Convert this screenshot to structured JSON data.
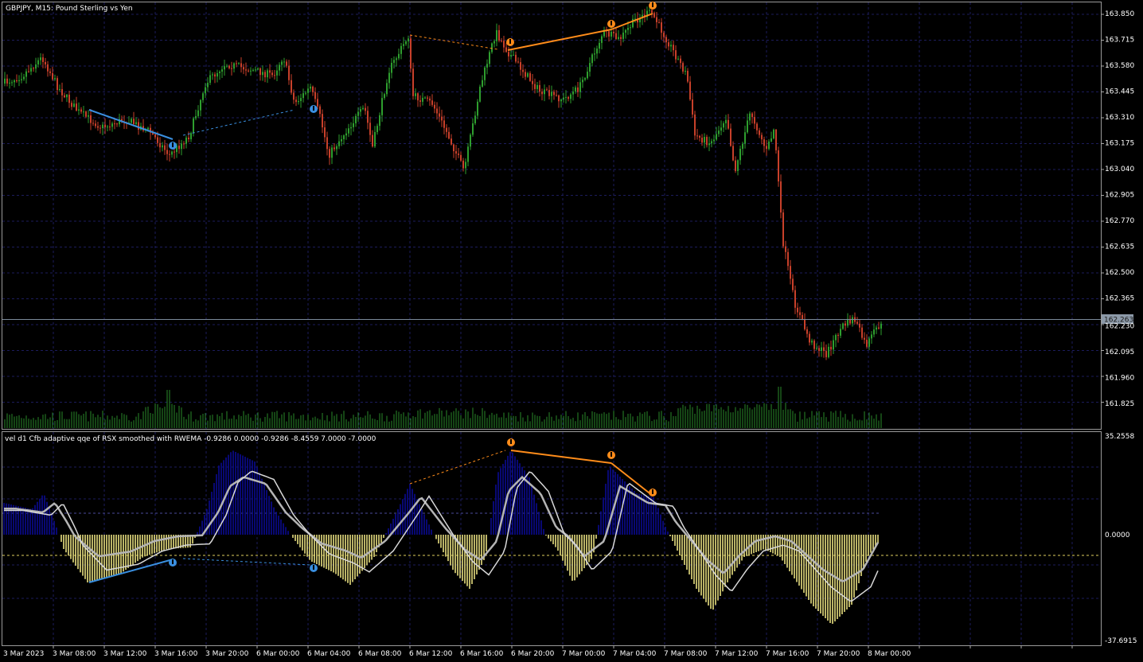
{
  "main": {
    "title": "GBPJPY, M15:  Pound Sterling vs Yen",
    "price_labels": [
      "163.850",
      "163.715",
      "163.580",
      "163.445",
      "163.310",
      "163.175",
      "163.040",
      "162.905",
      "162.770",
      "162.635",
      "162.500",
      "162.365",
      "162.230",
      "162.095",
      "161.960",
      "161.825"
    ],
    "current_price": "162.263"
  },
  "indicator": {
    "title": "vel d1 Cfb adaptive qqe of RSX smoothed with RWEMA -0.9286 0.0000 -0.9286 -8.4559 7.0000 -7.0000",
    "scale_labels": [
      "35.2558",
      "0.0000",
      "-37.6915"
    ]
  },
  "time_labels": [
    "3 Mar 2023",
    "3 Mar 08:00",
    "3 Mar 12:00",
    "3 Mar 16:00",
    "3 Mar 20:00",
    "6 Mar 00:00",
    "6 Mar 04:00",
    "6 Mar 08:00",
    "6 Mar 12:00",
    "6 Mar 16:00",
    "6 Mar 20:00",
    "7 Mar 00:00",
    "7 Mar 04:00",
    "7 Mar 08:00",
    "7 Mar 12:00",
    "7 Mar 16:00",
    "7 Mar 20:00",
    "8 Mar 00:00"
  ],
  "colors": {
    "background": "#000000",
    "grid": "#1c1c5c",
    "bull_candle": "#2e9e2e",
    "bear_candle": "#c8402a",
    "volume": "#2a8a2a",
    "positive_histogram": "#0a0a90",
    "negative_histogram": "#e8e080",
    "neutral_histogram": "#808080",
    "signal_line": "#b4b4b4",
    "bearish_divergence": "#ff8c1a",
    "bullish_divergence": "#3a8fe0",
    "price_line": "#7a8a9a"
  },
  "icons": [
    "bearish-divergence-arrow-icon",
    "bullish-divergence-arrow-icon"
  ]
}
